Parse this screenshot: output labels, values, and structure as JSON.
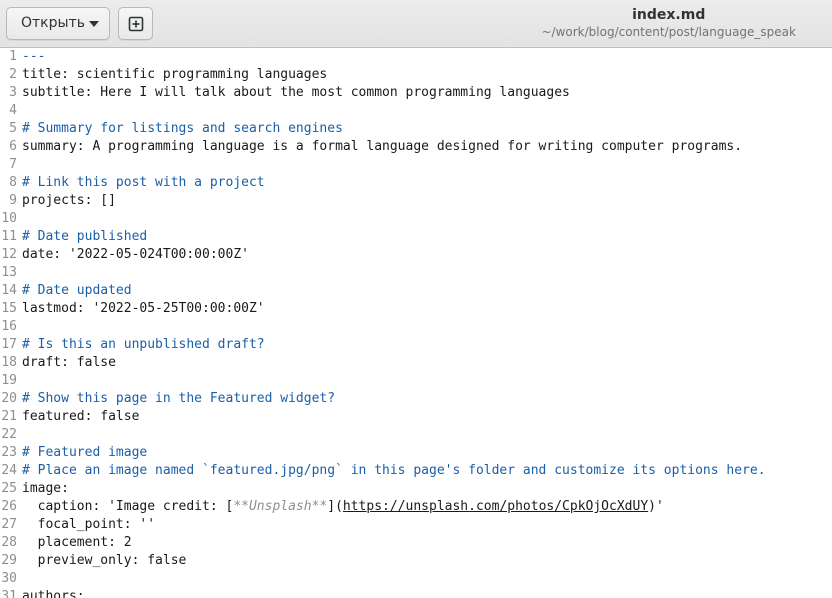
{
  "header": {
    "open_label": "Открыть",
    "title": "index.md",
    "subtitle": "~/work/blog/content/post/language_speak"
  },
  "editor": {
    "lines": [
      {
        "num": "1",
        "text": "---"
      },
      {
        "num": "2",
        "text": "title: scientific programming languages"
      },
      {
        "num": "3",
        "text": "subtitle: Here I will talk about the most common programming languages"
      },
      {
        "num": "4",
        "text": ""
      },
      {
        "num": "5",
        "text": "# Summary for listings and search engines"
      },
      {
        "num": "6",
        "text": "summary: A programming language is a formal language designed for writing computer programs."
      },
      {
        "num": "7",
        "text": ""
      },
      {
        "num": "8",
        "text": "# Link this post with a project"
      },
      {
        "num": "9",
        "text": "projects: []"
      },
      {
        "num": "10",
        "text": ""
      },
      {
        "num": "11",
        "text": "# Date published"
      },
      {
        "num": "12",
        "text": "date: '2022-05-024T00:00:00Z'"
      },
      {
        "num": "13",
        "text": ""
      },
      {
        "num": "14",
        "text": "# Date updated"
      },
      {
        "num": "15",
        "text": "lastmod: '2022-05-25T00:00:00Z'"
      },
      {
        "num": "16",
        "text": ""
      },
      {
        "num": "17",
        "text": "# Is this an unpublished draft?"
      },
      {
        "num": "18",
        "text": "draft: false"
      },
      {
        "num": "19",
        "text": ""
      },
      {
        "num": "20",
        "text": "# Show this page in the Featured widget?"
      },
      {
        "num": "21",
        "text": "featured: false"
      },
      {
        "num": "22",
        "text": ""
      },
      {
        "num": "23",
        "text": "# Featured image"
      },
      {
        "num": "24",
        "text": "# Place an image named `featured.jpg/png` in this page's folder and customize its options here."
      },
      {
        "num": "25",
        "text": "image:"
      },
      {
        "num": "26",
        "pre": "  caption: 'Image credit: [",
        "emph": "**Unsplash**",
        "mid": "](",
        "link": "https://unsplash.com/photos/CpkOjOcXdUY",
        "post": ")'"
      },
      {
        "num": "27",
        "text": "  focal_point: ''"
      },
      {
        "num": "28",
        "text": "  placement: 2"
      },
      {
        "num": "29",
        "text": "  preview_only: false"
      },
      {
        "num": "30",
        "text": ""
      },
      {
        "num": "31",
        "text": "authors:"
      }
    ]
  }
}
